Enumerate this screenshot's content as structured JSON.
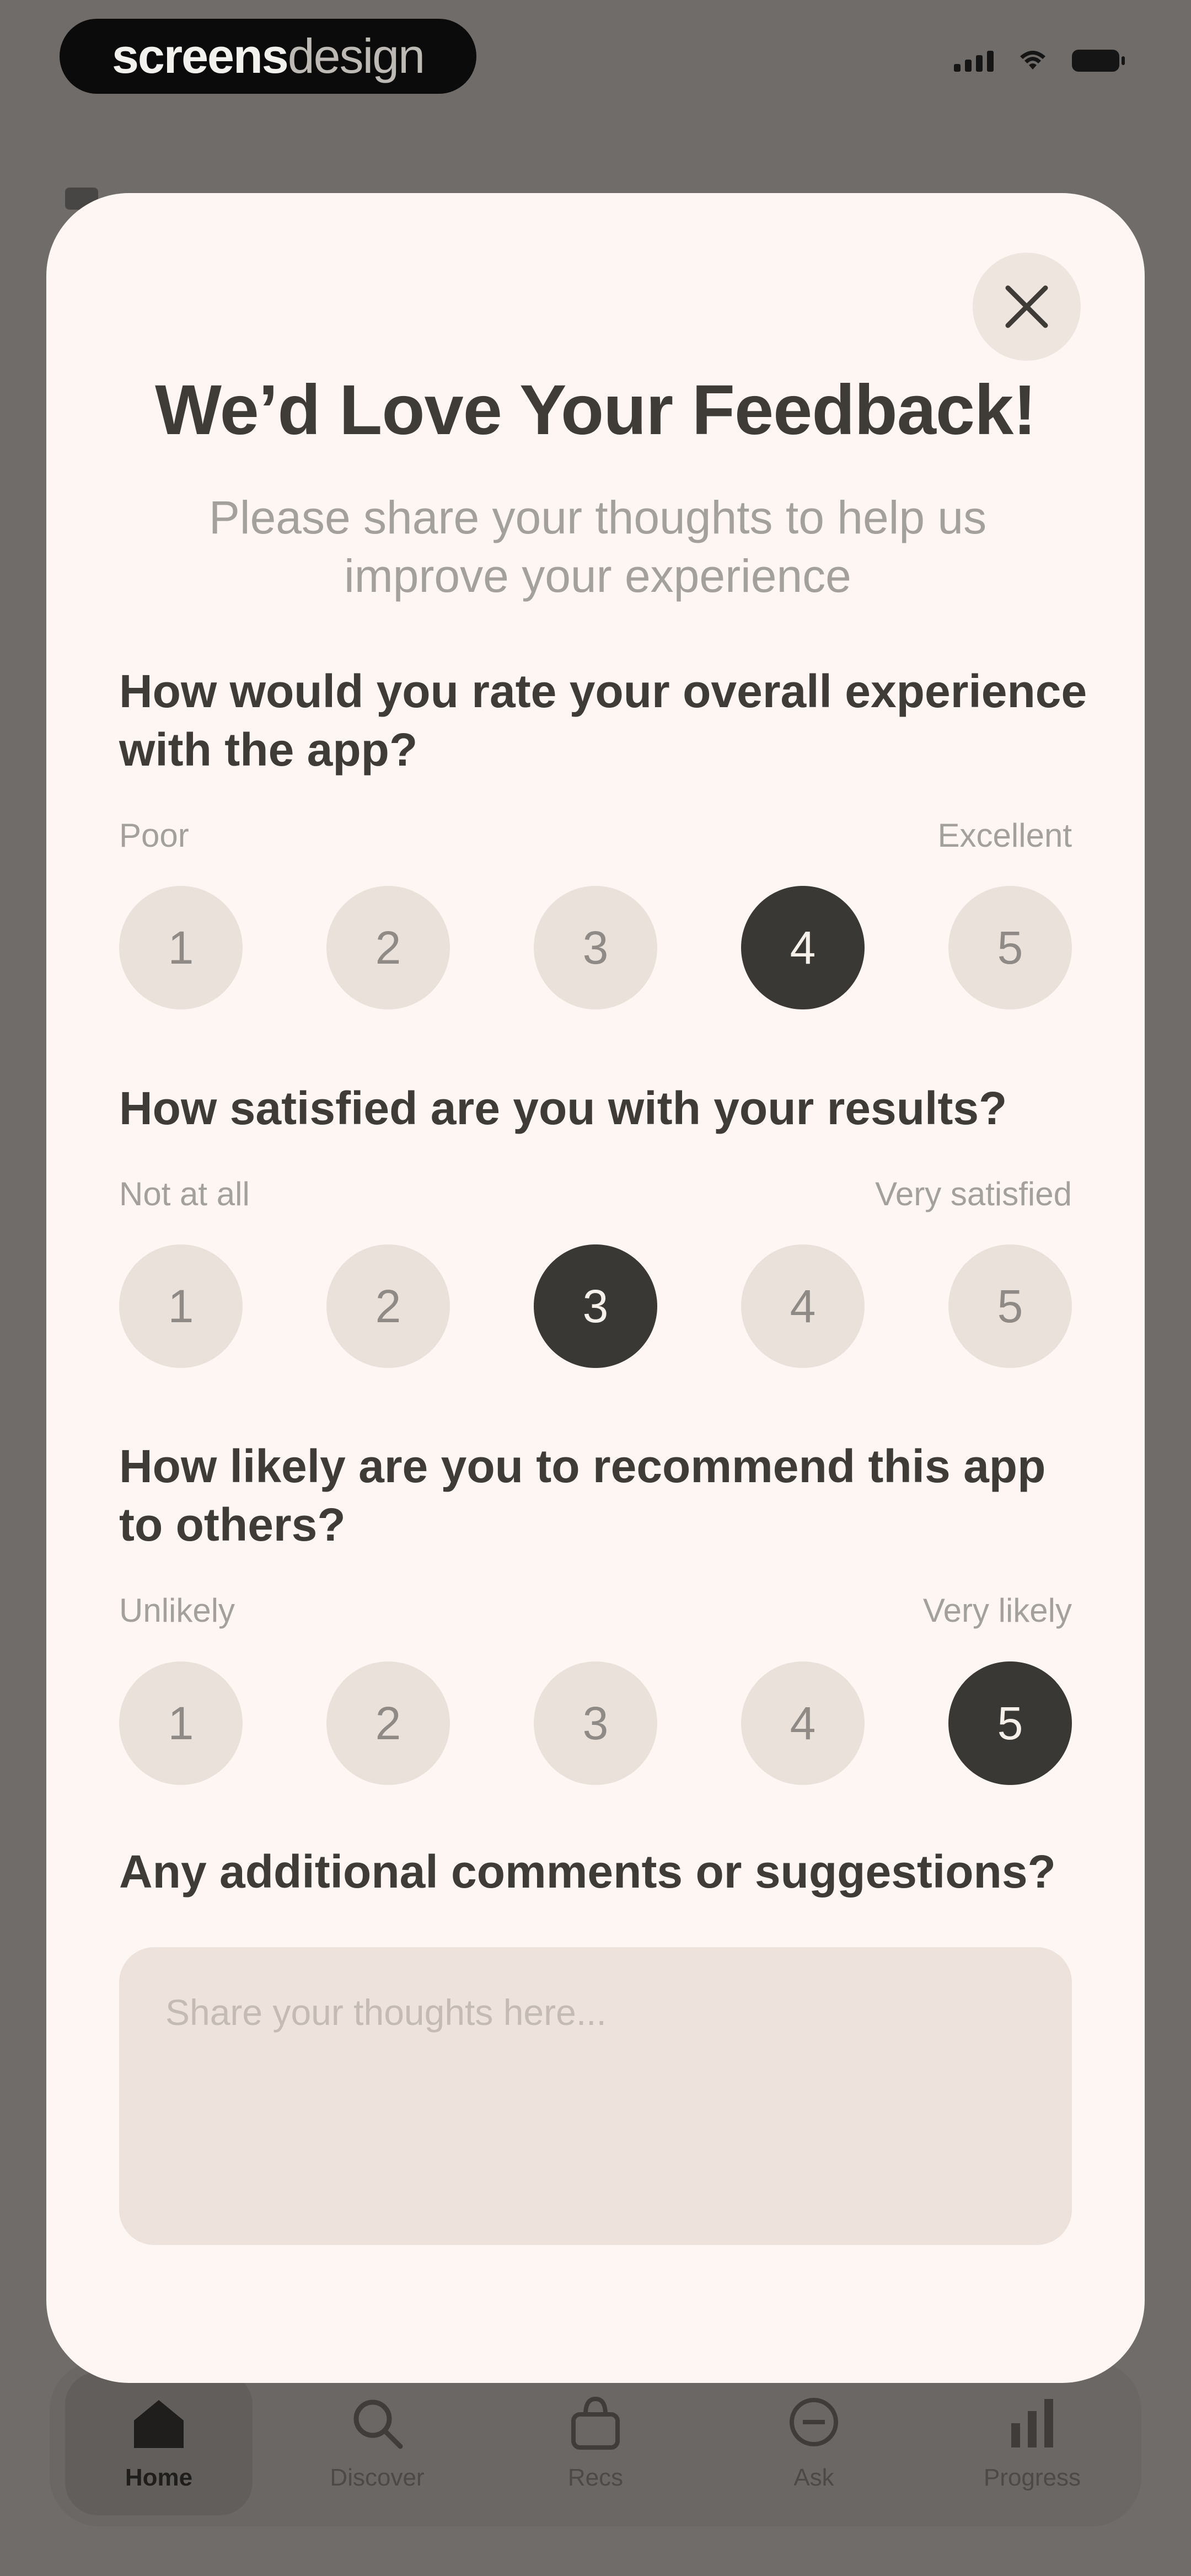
{
  "status_bar": {
    "brand_bold": "screens",
    "brand_light": "design"
  },
  "modal": {
    "close_icon": "close-icon",
    "title": "We’d Love Your Feedback!",
    "subtitle": "Please share your thoughts to help us improve your experience",
    "questions": [
      {
        "text": "How would you rate your overall experience with the app?",
        "low_label": "Poor",
        "high_label": "Excellent",
        "options": [
          "1",
          "2",
          "3",
          "4",
          "5"
        ],
        "selected": 4
      },
      {
        "text": "How satisfied are you with your results?",
        "low_label": "Not at all",
        "high_label": "Very satisfied",
        "options": [
          "1",
          "2",
          "3",
          "4",
          "5"
        ],
        "selected": 3
      },
      {
        "text": "How likely are you to recommend this app to others?",
        "low_label": "Unlikely",
        "high_label": "Very likely",
        "options": [
          "1",
          "2",
          "3",
          "4",
          "5"
        ],
        "selected": 5
      }
    ],
    "comments_label": "Any additional comments or suggestions?",
    "comments_placeholder": "Share your thoughts here...",
    "comments_value": ""
  },
  "tabbar": {
    "tabs": [
      {
        "label": "Home",
        "icon": "home-icon",
        "active": true
      },
      {
        "label": "Discover",
        "icon": "search-icon",
        "active": false
      },
      {
        "label": "Recs",
        "icon": "bag-icon",
        "active": false
      },
      {
        "label": "Ask",
        "icon": "chat-icon",
        "active": false
      },
      {
        "label": "Progress",
        "icon": "chart-icon",
        "active": false
      }
    ]
  },
  "colors": {
    "overlay": "#6f6c69",
    "modal_bg": "#fdf6f2",
    "option_bg": "#ebe1db",
    "option_selected_bg": "#3a3834",
    "heading_text": "#3f3b37",
    "muted_text": "#a4a09b"
  }
}
